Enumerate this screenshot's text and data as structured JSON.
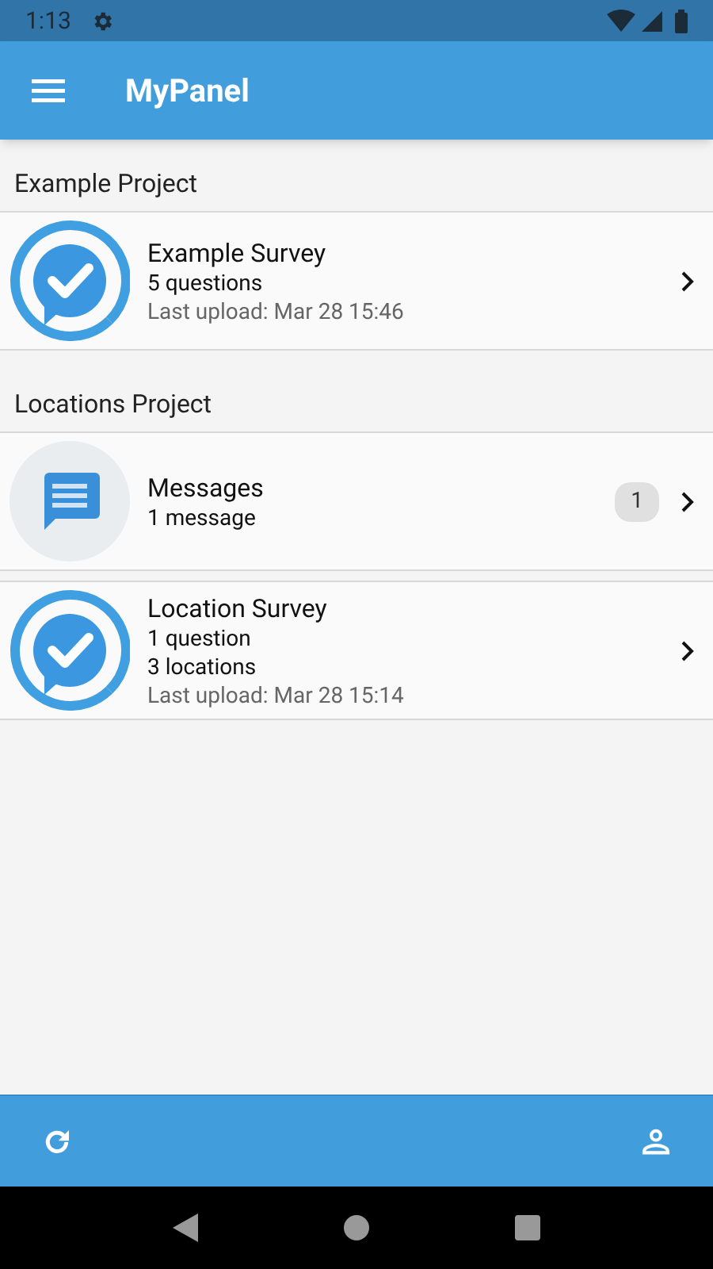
{
  "status_bar": {
    "time": "1:13"
  },
  "app_bar": {
    "title": "MyPanel"
  },
  "sections": [
    {
      "title": "Example Project",
      "items": [
        {
          "kind": "survey",
          "title": "Example Survey",
          "lines": [
            {
              "text": "5 questions",
              "muted": false
            },
            {
              "text": "Last upload: Mar 28 15:46",
              "muted": true
            }
          ]
        }
      ]
    },
    {
      "title": "Locations Project",
      "items": [
        {
          "kind": "messages",
          "title": "Messages",
          "lines": [
            {
              "text": "1 message",
              "muted": false
            }
          ],
          "badge": "1"
        },
        {
          "kind": "survey",
          "title": "Location Survey",
          "lines": [
            {
              "text": "1 question",
              "muted": false
            },
            {
              "text": "3 locations",
              "muted": false
            },
            {
              "text": "Last upload: Mar 28 15:14",
              "muted": true
            }
          ]
        }
      ]
    }
  ]
}
